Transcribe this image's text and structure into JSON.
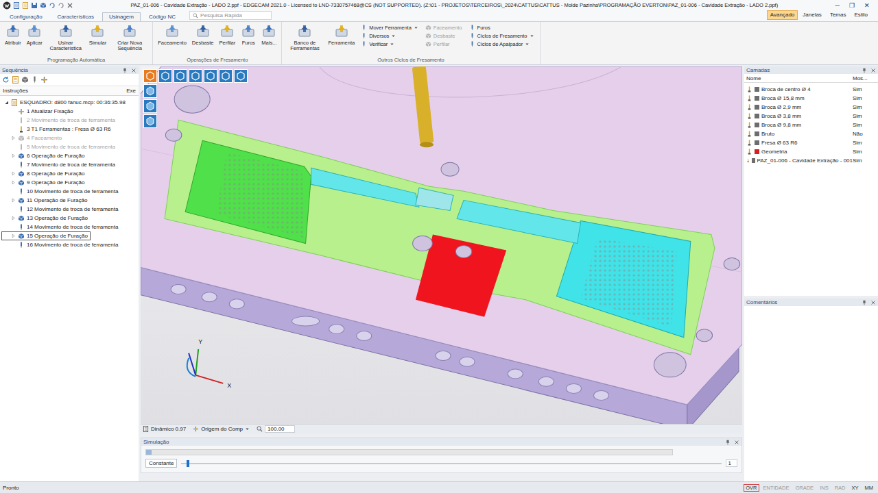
{
  "window": {
    "title": "PAZ_01-006 - Cavidade Extração - LADO 2.ppf - EDGECAM 2021.0 - Licensed to LND-7330757468@CS (NOT SUPPORTED). (Z:\\01 - PROJETOS\\TERCEIROS\\_2024\\CATTUS\\CATTUS - Molde Pazinha\\PROGRAMAÇÃO EVERTON\\PAZ_01-006 - Cavidade Extração - LADO 2.ppf)",
    "controls": [
      "─",
      "❐",
      "✕"
    ]
  },
  "menu_tabs": [
    {
      "label": "Configuração",
      "selected": false
    },
    {
      "label": "Características",
      "selected": false
    },
    {
      "label": "Usinagem",
      "selected": true
    },
    {
      "label": "Código NC",
      "selected": false
    }
  ],
  "search": {
    "placeholder": "Pesquisa Rápida"
  },
  "right_menu": [
    {
      "label": "Avançado",
      "selected": true
    },
    {
      "label": "Janelas",
      "selected": false
    },
    {
      "label": "Temas",
      "selected": false
    },
    {
      "label": "Estilo",
      "selected": false
    }
  ],
  "ribbon": {
    "groups": [
      {
        "label": "Programação Automática",
        "large": [
          "Atribuir",
          "Aplicar",
          "Usinar Característica",
          "Simular",
          "Criar Nova Sequência"
        ],
        "small": []
      },
      {
        "label": "Operações de Fresamento",
        "large": [
          "Faceamento",
          "Desbaste",
          "Perfilar",
          "Furos",
          "Mais..."
        ],
        "small": []
      },
      {
        "label": "Outros Ciclos de Fresamento",
        "large": [
          "Banco de Ferramentas",
          "Ferramenta"
        ],
        "small": [
          [
            {
              "label": "Mover Ferramenta",
              "disabled": false,
              "dropdown": true
            },
            {
              "label": "Diversos",
              "disabled": false,
              "dropdown": true
            },
            {
              "label": "Verificar",
              "disabled": false,
              "dropdown": true
            }
          ],
          [
            {
              "label": "Faceamento",
              "disabled": true,
              "dropdown": false
            },
            {
              "label": "Desbaste",
              "disabled": true,
              "dropdown": false
            },
            {
              "label": "Perfilar",
              "disabled": true,
              "dropdown": false
            }
          ],
          [
            {
              "label": "Furos",
              "disabled": false,
              "dropdown": false
            },
            {
              "label": "Ciclos de Fresamento",
              "disabled": false,
              "dropdown": true
            },
            {
              "label": "Ciclos de Apalpador",
              "disabled": false,
              "dropdown": true
            }
          ]
        ]
      }
    ]
  },
  "sequence_panel": {
    "title": "Sequência",
    "columns": [
      "Instruções",
      "Exe"
    ],
    "root": {
      "label": "ESQUADRO: d800 fanuc.mcp: 00:36:35.98",
      "expanded": true
    },
    "items": [
      {
        "label": "1 Atualizar Fixação",
        "kind": "fixture",
        "disabled": false,
        "expandable": false,
        "selected": false
      },
      {
        "label": "2 Movimento de troca de ferramenta",
        "kind": "toolchange",
        "disabled": true,
        "expandable": false,
        "selected": false
      },
      {
        "label": "3 T1 Ferramentas : Fresa Ø 63 R6",
        "kind": "tool",
        "disabled": false,
        "expandable": false,
        "selected": false
      },
      {
        "label": "4 Faceamento",
        "kind": "op",
        "disabled": true,
        "expandable": true,
        "selected": false
      },
      {
        "label": "5 Movimento de troca de ferramenta",
        "kind": "toolchange",
        "disabled": true,
        "expandable": false,
        "selected": false
      },
      {
        "label": "6 Operação de Furação",
        "kind": "op",
        "disabled": false,
        "expandable": true,
        "selected": false
      },
      {
        "label": "7 Movimento de troca de ferramenta",
        "kind": "toolchange",
        "disabled": false,
        "expandable": false,
        "selected": false
      },
      {
        "label": "8 Operação de Furação",
        "kind": "op",
        "disabled": false,
        "expandable": true,
        "selected": false
      },
      {
        "label": "9 Operação de Furação",
        "kind": "op",
        "disabled": false,
        "expandable": true,
        "selected": false
      },
      {
        "label": "10 Movimento de troca de ferramenta",
        "kind": "toolchange",
        "disabled": false,
        "expandable": false,
        "selected": false
      },
      {
        "label": "11 Operação de Furação",
        "kind": "op",
        "disabled": false,
        "expandable": true,
        "selected": false
      },
      {
        "label": "12 Movimento de troca de ferramenta",
        "kind": "toolchange",
        "disabled": false,
        "expandable": false,
        "selected": false
      },
      {
        "label": "13 Operação de Furação",
        "kind": "op",
        "disabled": false,
        "expandable": true,
        "selected": false
      },
      {
        "label": "14 Movimento de troca de ferramenta",
        "kind": "toolchange",
        "disabled": false,
        "expandable": false,
        "selected": false
      },
      {
        "label": "15 Operação de Furação",
        "kind": "op",
        "disabled": false,
        "expandable": true,
        "selected": true
      },
      {
        "label": "16 Movimento de troca de ferramenta",
        "kind": "toolchange",
        "disabled": false,
        "expandable": false,
        "selected": false
      }
    ]
  },
  "viewport": {
    "axes": {
      "x": "X",
      "y": "Y"
    },
    "status": {
      "mode": "Dinâmico 0.97",
      "origin": "Origem do Comp",
      "zoom": "100.00"
    }
  },
  "simulation": {
    "title": "Simulação",
    "mode": "Constante",
    "value": "1",
    "level": 0.01
  },
  "layers_panel": {
    "title": "Camadas",
    "columns": [
      "Nome",
      "Mos..."
    ],
    "rows": [
      {
        "name": "Broca de centro Ø 4",
        "shown": "Sim",
        "color": "#6d6d6d"
      },
      {
        "name": "Broca Ø 15,8 mm",
        "shown": "Sim",
        "color": "#6d6d6d"
      },
      {
        "name": "Broca Ø 2,9 mm",
        "shown": "Sim",
        "color": "#6d6d6d"
      },
      {
        "name": "Broca Ø 3,8 mm",
        "shown": "Sim",
        "color": "#6d6d6d"
      },
      {
        "name": "Broca Ø 9,8 mm",
        "shown": "Sim",
        "color": "#6d6d6d"
      },
      {
        "name": "Bruto",
        "shown": "Não",
        "color": "#6d6d6d"
      },
      {
        "name": "Fresa Ø 63 R6",
        "shown": "Sim",
        "color": "#6d6d6d"
      },
      {
        "name": "Geometria",
        "shown": "Sim",
        "color": "#d42020"
      },
      {
        "name": "PAZ_01-006 - Cavidade Extração - 001",
        "shown": "Sim",
        "color": "#6d6d6d"
      }
    ]
  },
  "comments_panel": {
    "title": "Comentários"
  },
  "status_bar": {
    "text": "Pronto",
    "indicators": [
      {
        "label": "OVR",
        "active": true
      },
      {
        "label": "ENTIDADE",
        "active": false
      },
      {
        "label": "GRADE",
        "active": false
      },
      {
        "label": "INS",
        "active": false
      },
      {
        "label": "RAD",
        "active": false
      },
      {
        "label": "XY",
        "active": true
      },
      {
        "label": "MM",
        "active": true
      }
    ]
  }
}
